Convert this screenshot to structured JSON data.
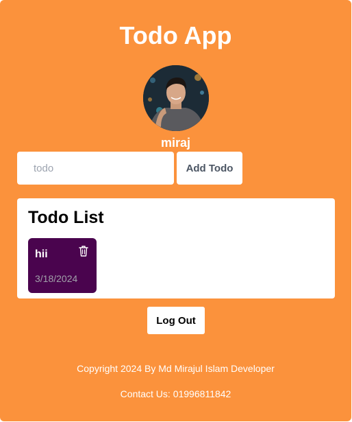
{
  "app": {
    "title": "Todo App",
    "background_color": "#fb923c"
  },
  "user": {
    "name": "miraj",
    "avatar": "user-photo"
  },
  "form": {
    "input_placeholder": "todo",
    "input_value": "",
    "add_button_label": "Add Todo"
  },
  "todo_list": {
    "heading": "Todo List",
    "items": [
      {
        "text": "hii",
        "date": "3/18/2024",
        "delete_icon": "trash-icon",
        "color": "#4a044e"
      }
    ]
  },
  "actions": {
    "logout_label": "Log Out"
  },
  "footer": {
    "copyright": "Copyright 2024 By Md Mirajul Islam Developer",
    "contact": "Contact Us: 01996811842"
  }
}
